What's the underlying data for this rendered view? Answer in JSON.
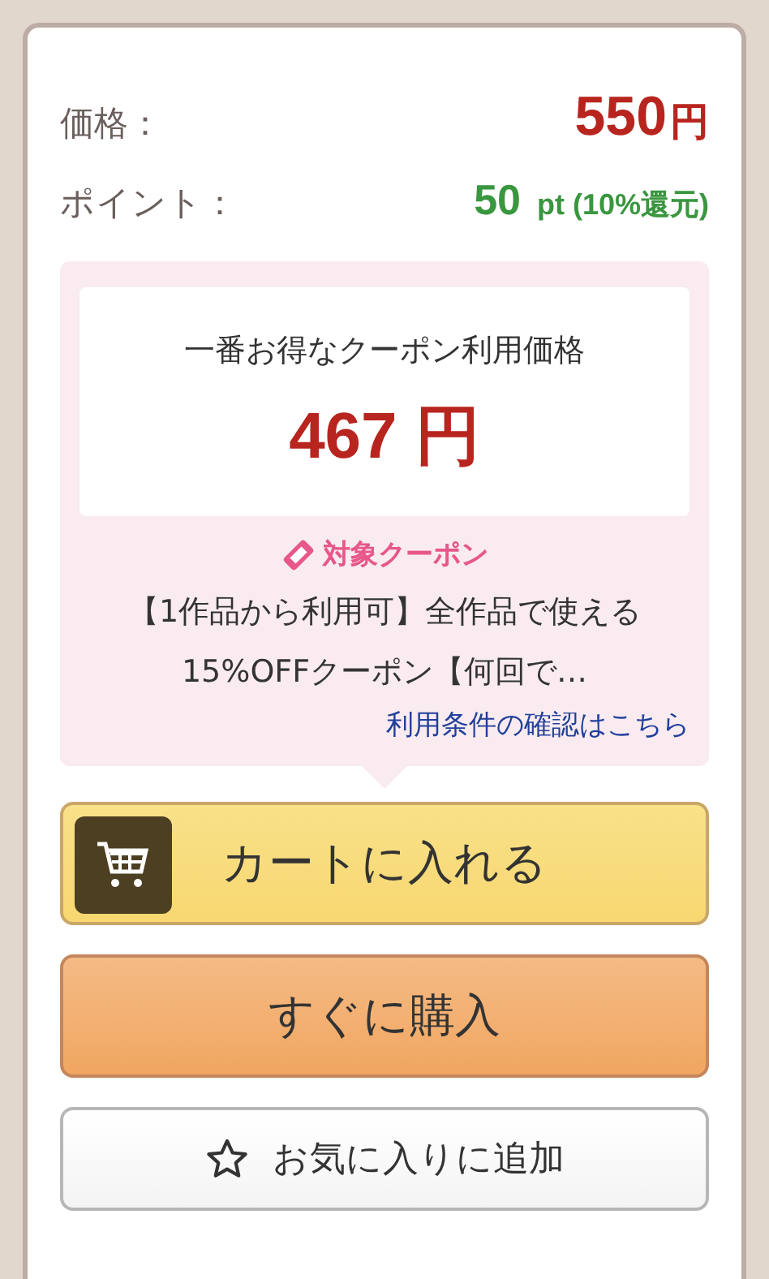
{
  "price": {
    "label": "価格：",
    "amount": "550",
    "unit": "円"
  },
  "points": {
    "label": "ポイント：",
    "amount": "50",
    "detail": "pt (10%還元)"
  },
  "coupon": {
    "best_label": "一番お得なクーポン利用価格",
    "best_price": "467 円",
    "heading": "対象クーポン",
    "description": "【1作品から利用可】全作品で使える15%OFFクーポン【何回で…",
    "terms_link": "利用条件の確認はこちら"
  },
  "buttons": [
    {
      "kind": "cart",
      "label": "カートに入れる"
    },
    {
      "kind": "buy",
      "label": "すぐに購入"
    },
    {
      "kind": "favorite",
      "label": "お気に入りに追加"
    }
  ]
}
